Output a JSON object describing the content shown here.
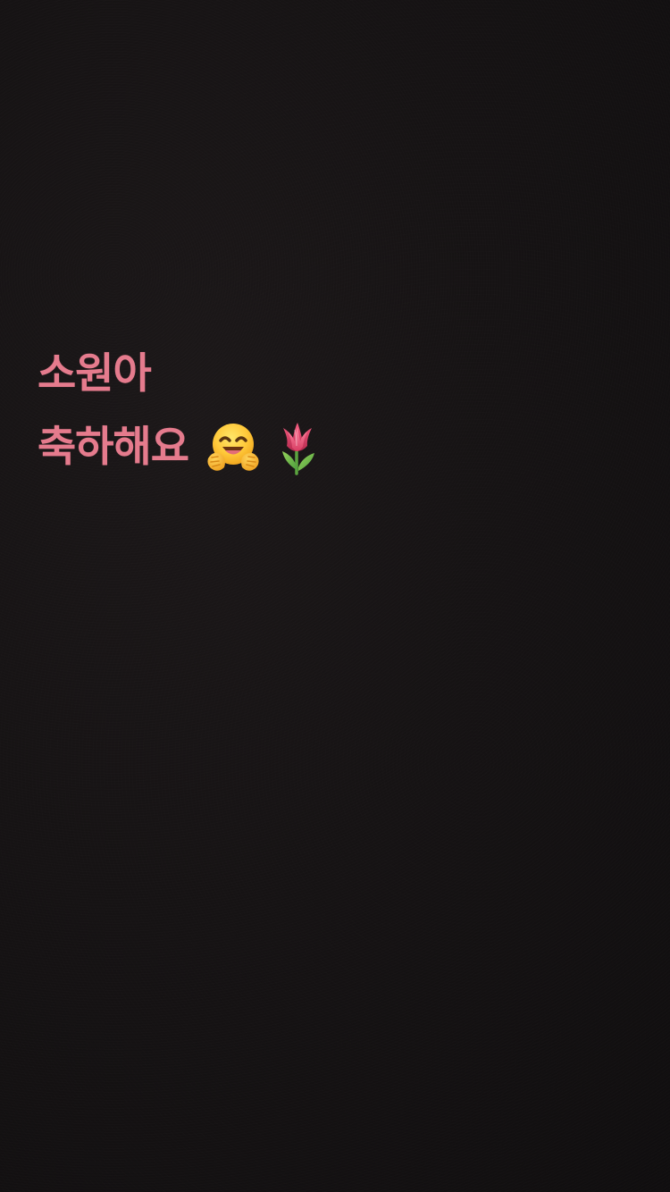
{
  "story": {
    "line1": "소원아",
    "line2": "축하해요",
    "emojis": [
      "hugging-face-icon",
      "tulip-icon"
    ],
    "text_color": "#e57b8d",
    "background_color": "#141213"
  }
}
